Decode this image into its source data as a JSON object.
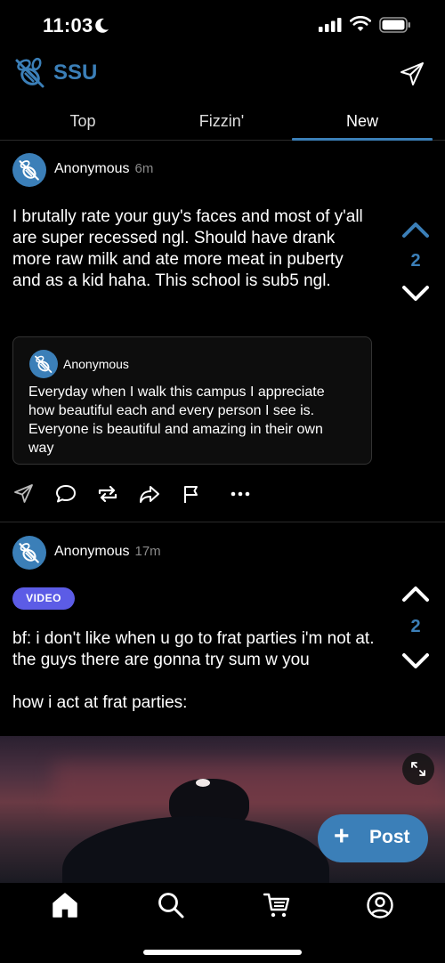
{
  "status_bar": {
    "time": "11:03"
  },
  "header": {
    "school": "SSU"
  },
  "tabs": [
    {
      "label": "Top"
    },
    {
      "label": "Fizzin'"
    },
    {
      "label": "New"
    }
  ],
  "active_tab": "New",
  "posts": [
    {
      "author": "Anonymous",
      "age": "6m",
      "text": "I brutally rate your guy's faces and most of y'all are super recessed ngl. Should have drank more raw milk and ate more meat in puberty and as a kid haha. This school is sub5 ngl.",
      "votes": "2",
      "quote": {
        "author": "Anonymous",
        "text": "Everyday when I walk this campus I appreciate how beautiful each and every person I see is. Everyone is beautiful and amazing in their own way"
      }
    },
    {
      "author": "Anonymous",
      "age": "17m",
      "badge": "VIDEO",
      "text": "bf: i don't like when u go to frat parties i'm not at. the guys there are gonna try sum w you\n\nhow i act at frat parties:",
      "votes": "2"
    }
  ],
  "fab": {
    "plus": "+",
    "label": "Post"
  },
  "colors": {
    "accent": "#3b7fb8",
    "video_badge": "#5c5ce6",
    "background": "#000000"
  },
  "icons": {
    "header": [
      "bee-logo-icon",
      "send-icon"
    ],
    "actions": [
      "share-icon",
      "comment-icon",
      "repost-icon",
      "forward-icon",
      "flag-icon",
      "more-icon"
    ],
    "nav": [
      "home-icon",
      "search-icon",
      "cart-icon",
      "profile-icon"
    ]
  }
}
